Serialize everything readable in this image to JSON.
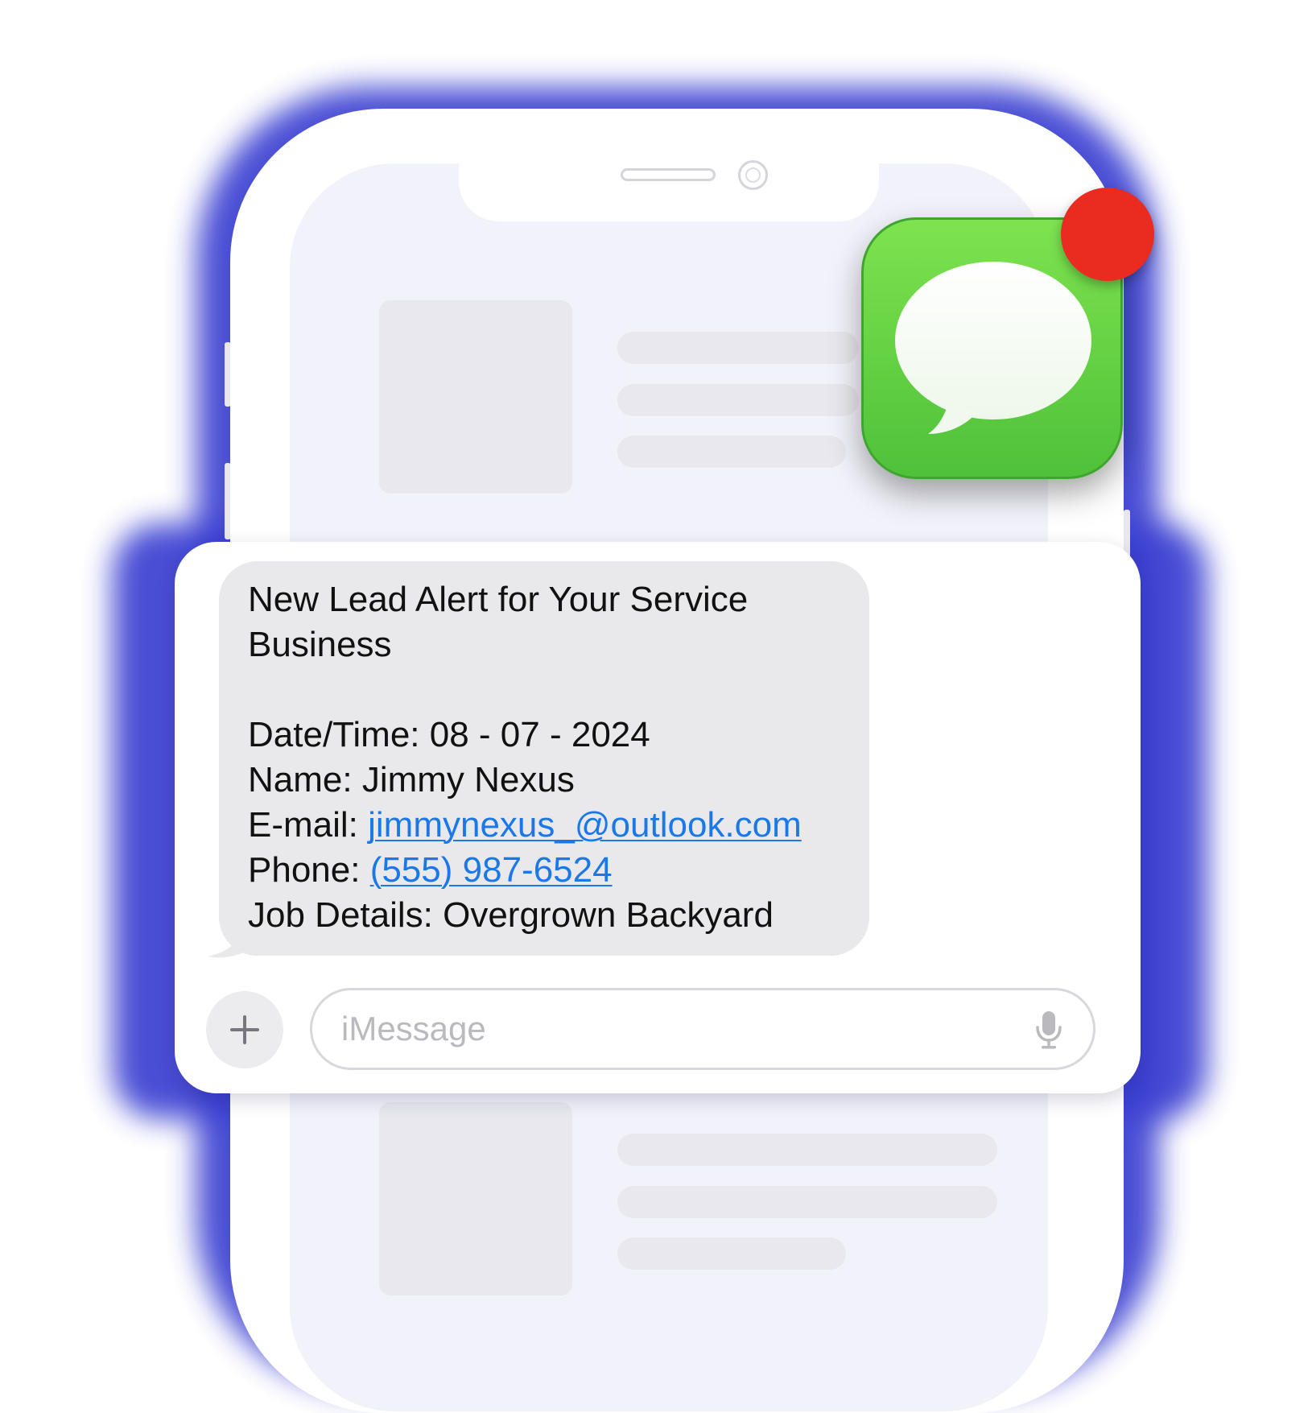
{
  "message": {
    "lines": [
      "New Lead Alert for Your Service",
      "Business",
      "",
      "Date/Time:  08 - 07 - 2024",
      "Name: Jimmy Nexus"
    ],
    "email_label": "E-mail: ",
    "email_value": "jimmynexus_@outlook.com",
    "phone_label": "Phone: ",
    "phone_value": "(555) 987-6524",
    "job_details": "Job Details: Overgrown Backyard"
  },
  "input": {
    "placeholder": "iMessage"
  },
  "icons": {
    "app": "messages-app-icon",
    "badge": "notification-badge",
    "add": "plus-icon",
    "mic": "microphone-icon"
  },
  "colors": {
    "glow": "#3a3fd1",
    "app_icon_green": "#5fd13f",
    "badge_red": "#ea2b20",
    "link_blue": "#1b78e8",
    "bubble_gray": "#e9e9eb"
  }
}
